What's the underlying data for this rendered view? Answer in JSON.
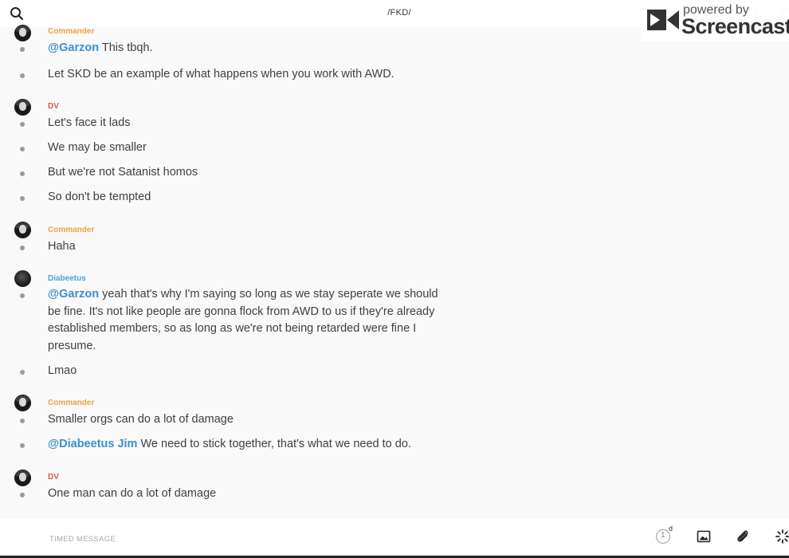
{
  "header": {
    "channel_title": "/FKD/"
  },
  "watermark": {
    "line1": "powered by",
    "line2": "Screencastify"
  },
  "colors": {
    "commander": "#f0a23a",
    "dv": "#e05a4f",
    "diabeetus": "#4aa3df",
    "mention": "#3b8fd0"
  },
  "groups": [
    {
      "author": "Commander",
      "messages": [
        {
          "mention": "@Garzon",
          "text": " This tbqh."
        },
        {
          "mention": "",
          "text": "Let SKD be an example of what happens when you work with AWD."
        }
      ]
    },
    {
      "author": "DV",
      "messages": [
        {
          "mention": "",
          "text": "Let's face it lads"
        },
        {
          "mention": "",
          "text": "We may be smaller"
        },
        {
          "mention": "",
          "text": "But we're not Satanist homos"
        },
        {
          "mention": "",
          "text": "So don't be tempted"
        }
      ]
    },
    {
      "author": "Commander",
      "messages": [
        {
          "mention": "",
          "text": "Haha"
        }
      ]
    },
    {
      "author": "Diabeetus",
      "messages": [
        {
          "mention": "@Garzon",
          "text": " yeah that's why I'm saying so long as we stay seperate we should be fine. It's not like people are gonna flock from AWD to us if they're already established members, so as long as we're not being retarded were fine I presume."
        },
        {
          "mention": "",
          "text": "Lmao"
        }
      ]
    },
    {
      "author": "Commander",
      "messages": [
        {
          "mention": "",
          "text": "Smaller orgs can do a lot of damage"
        },
        {
          "mention": "@Diabeetus Jim",
          "text": " We need to stick together, that's what we need to do."
        }
      ]
    },
    {
      "author": "DV",
      "messages": [
        {
          "mention": "",
          "text": "One man can do a lot of damage"
        }
      ]
    }
  ],
  "composer": {
    "placeholder": "TIMED MESSAGE",
    "expiry_value": "1",
    "expiry_unit": "d"
  },
  "icons": {
    "search": "search-icon",
    "phone": "phone-icon",
    "info": "info-icon",
    "image": "image-icon",
    "attach": "paperclip-icon",
    "more": "spinner-icon"
  }
}
